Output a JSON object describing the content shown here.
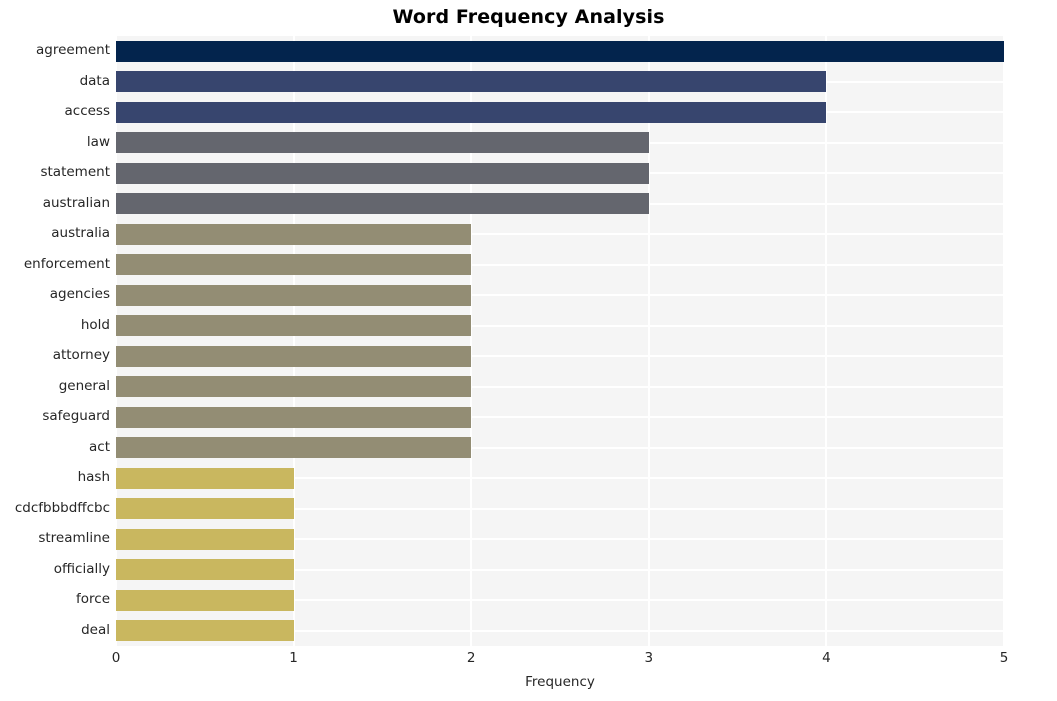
{
  "chart_data": {
    "type": "bar",
    "orientation": "horizontal",
    "title": "Word Frequency Analysis",
    "xlabel": "Frequency",
    "ylabel": "",
    "xlim": [
      0,
      5
    ],
    "xticks": [
      "0",
      "1",
      "2",
      "3",
      "4",
      "5"
    ],
    "grid": true,
    "legend": "none",
    "categories": [
      "agreement",
      "data",
      "access",
      "law",
      "statement",
      "australian",
      "australia",
      "enforcement",
      "agencies",
      "hold",
      "attorney",
      "general",
      "safeguard",
      "act",
      "hash",
      "cdcfbbbdffcbc",
      "streamline",
      "officially",
      "force",
      "deal"
    ],
    "values": [
      5,
      4,
      4,
      3,
      3,
      3,
      2,
      2,
      2,
      2,
      2,
      2,
      2,
      2,
      1,
      1,
      1,
      1,
      1,
      1
    ],
    "bar_colors": [
      "#03244d",
      "#37456e",
      "#37456e",
      "#64666e",
      "#64666e",
      "#64666e",
      "#938d74",
      "#938d74",
      "#938d74",
      "#938d74",
      "#938d74",
      "#938d74",
      "#938d74",
      "#938d74",
      "#c9b75f",
      "#c9b75f",
      "#c9b75f",
      "#c9b75f",
      "#c9b75f",
      "#c9b75f"
    ]
  },
  "style": {
    "plot_background": "#f5f5f5",
    "grid_color": "#ffffff",
    "figure_background": "#ffffff",
    "text_color": "#262626"
  }
}
